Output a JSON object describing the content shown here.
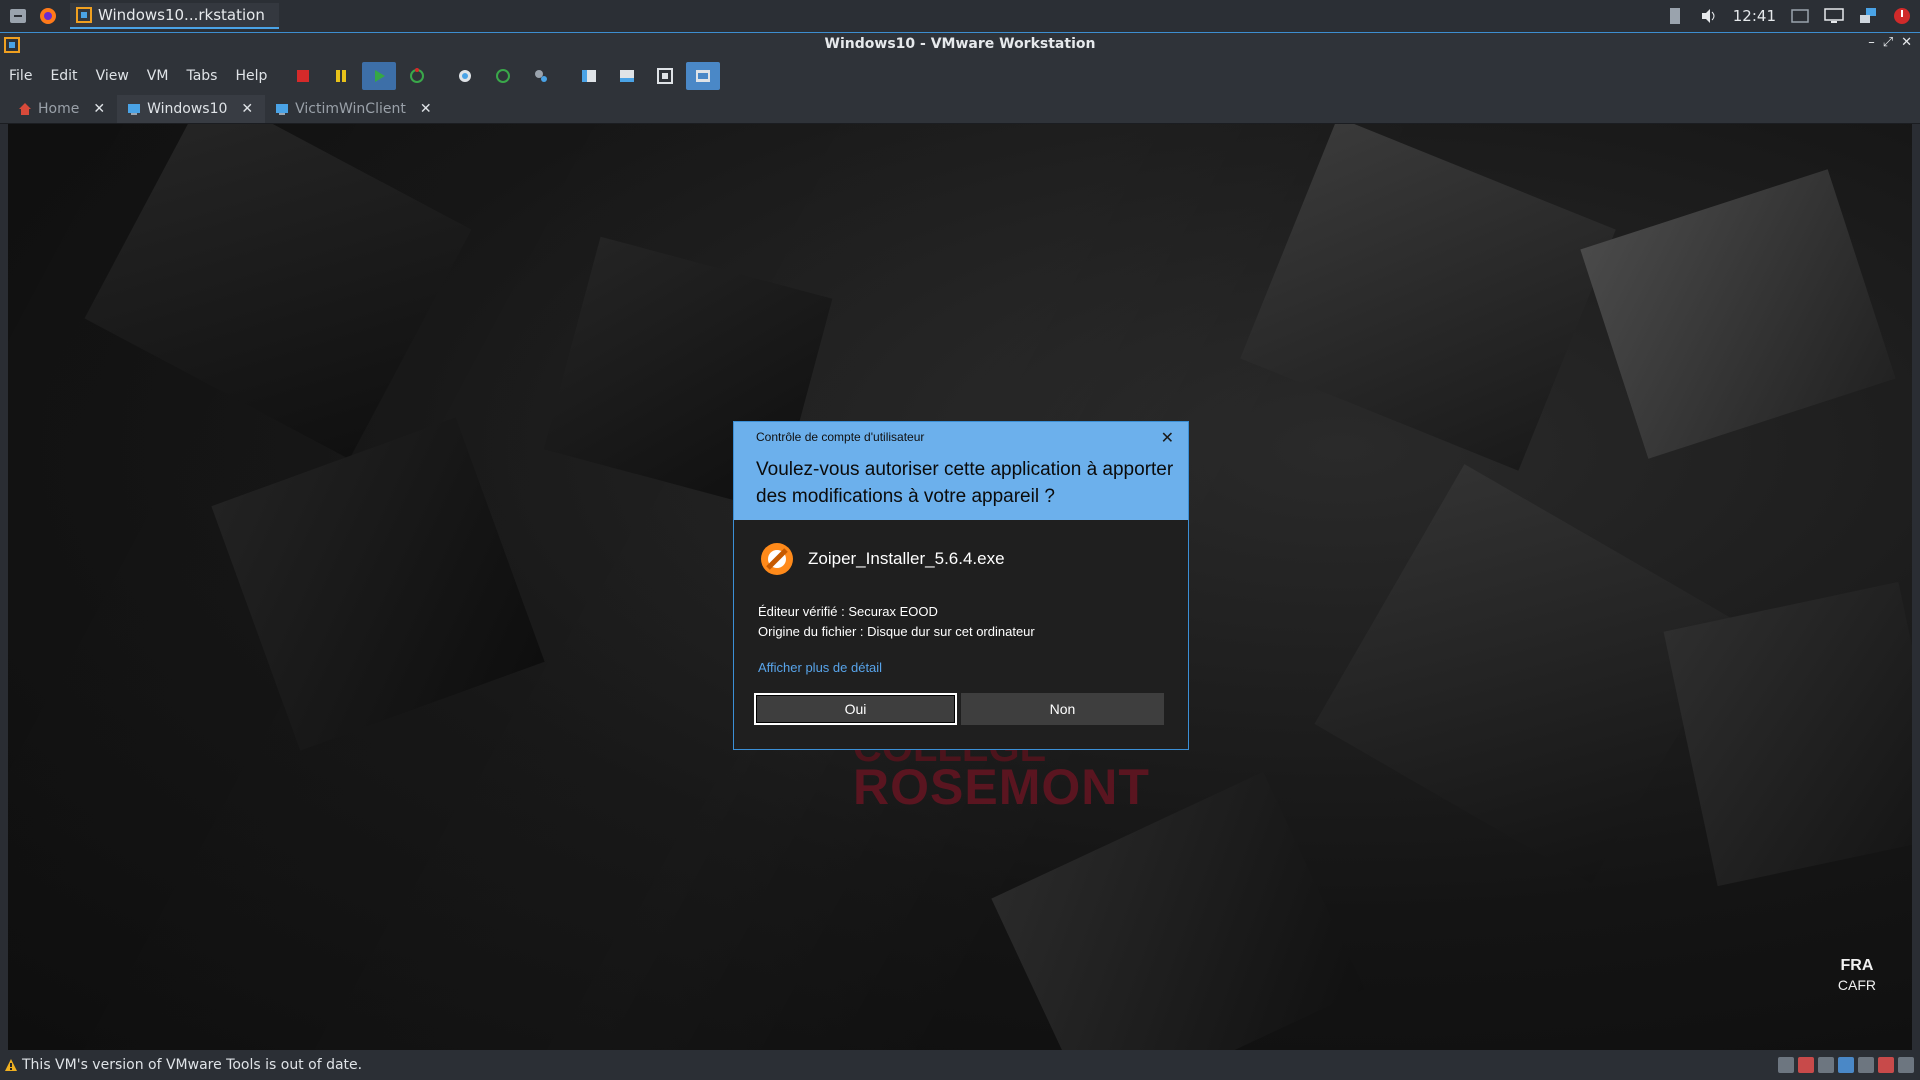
{
  "host_panel": {
    "task_label": "Windows10...rkstation",
    "clock": "12:41"
  },
  "window": {
    "title": "Windows10 - VMware Workstation"
  },
  "menu": {
    "items": [
      "File",
      "Edit",
      "View",
      "VM",
      "Tabs",
      "Help"
    ]
  },
  "tabs": [
    {
      "label": "Home",
      "active": false
    },
    {
      "label": "Windows10",
      "active": true
    },
    {
      "label": "VictimWinClient",
      "active": false
    }
  ],
  "guest": {
    "logo_top": "COLLÈGE",
    "logo_bottom": "ROSEMONT",
    "lang_primary": "FRA",
    "lang_secondary": "CAFR"
  },
  "uac": {
    "caption": "Contrôle de compte d'utilisateur",
    "question": "Voulez-vous autoriser cette application à apporter des modifications à votre appareil ?",
    "app_name": "Zoiper_Installer_5.6.4.exe",
    "publisher": "Éditeur vérifié : Securax EOOD",
    "origin": "Origine du fichier : Disque dur sur cet ordinateur",
    "more_details": "Afficher plus de détail",
    "yes": "Oui",
    "no": "Non"
  },
  "status": {
    "message": "This VM's version of VMware Tools is out of date."
  },
  "colors": {
    "accent": "#3b8fd6",
    "uac_header": "#6cb0ec",
    "logo_red": "#5a1520"
  }
}
